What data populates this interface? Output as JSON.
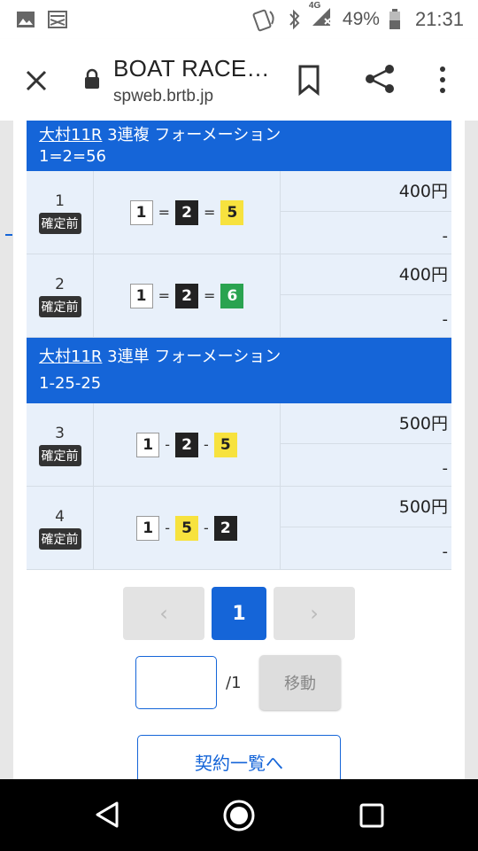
{
  "status_bar": {
    "battery_text": "49%",
    "time": "21:31",
    "network": "4G"
  },
  "browser": {
    "title": "BOAT RACE…",
    "url": "spweb.brtb.jp"
  },
  "sections": [
    {
      "race_link": "大村11R",
      "bet_type": "3連複 フォーメーション",
      "formation": "1=2=56",
      "rows": [
        {
          "no": "1",
          "status": "確定前",
          "combo": [
            "1",
            "2",
            "5"
          ],
          "sep": "=",
          "amount": "400円",
          "payout": "-"
        },
        {
          "no": "2",
          "status": "確定前",
          "combo": [
            "1",
            "2",
            "6"
          ],
          "sep": "=",
          "amount": "400円",
          "payout": "-"
        }
      ]
    },
    {
      "race_link": "大村11R",
      "bet_type": "3連単 フォーメーション",
      "formation": "1-25-25",
      "rows": [
        {
          "no": "3",
          "status": "確定前",
          "combo": [
            "1",
            "2",
            "5"
          ],
          "sep": "-",
          "amount": "500円",
          "payout": "-"
        },
        {
          "no": "4",
          "status": "確定前",
          "combo": [
            "1",
            "5",
            "2"
          ],
          "sep": "-",
          "amount": "500円",
          "payout": "-"
        }
      ]
    }
  ],
  "pagination": {
    "prev": "‹",
    "current": "1",
    "next": "›"
  },
  "goto": {
    "total": "/1",
    "button": "移動"
  },
  "list_button": "契約一覧へ"
}
